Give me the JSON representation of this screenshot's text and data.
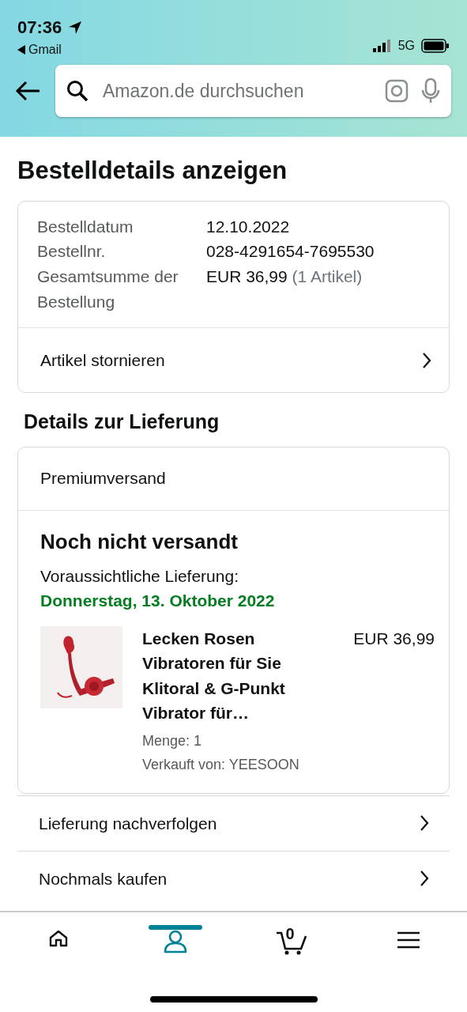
{
  "status_bar": {
    "time": "07:36",
    "back_app": "Gmail",
    "network": "5G"
  },
  "search": {
    "placeholder": "Amazon.de durchsuchen"
  },
  "page_title": "Bestelldetails anzeigen",
  "order": {
    "rows": [
      {
        "label": "Bestelldatum",
        "value": "12.10.2022"
      },
      {
        "label": "Bestellnr.",
        "value": "028-4291654-7695530"
      },
      {
        "label": "Gesamtsumme der Bestellung",
        "value": "EUR 36,99",
        "note": "(1 Artikel)"
      }
    ],
    "action": "Artikel stornieren"
  },
  "delivery": {
    "title": "Details zur Lieferung",
    "shipping": "Premiumversand",
    "status": "Noch nicht versandt",
    "estimate_label": "Voraussichtliche Lieferung:",
    "estimate_date": "Donnerstag, 13. Oktober 2022",
    "item": {
      "title": "Lecken Rosen Vibratoren für Sie Klitoral & G-Punkt Vibrator für…",
      "price": "EUR 36,99",
      "quantity": "Menge: 1",
      "seller": "Verkauft von: YEESOON"
    }
  },
  "links": [
    "Lieferung nachverfolgen",
    "Nochmals kaufen"
  ],
  "nav": [
    {
      "kind": "home",
      "selected": false
    },
    {
      "kind": "account",
      "selected": true
    },
    {
      "kind": "cart",
      "count": "0",
      "selected": false
    },
    {
      "kind": "menu",
      "selected": false
    }
  ]
}
